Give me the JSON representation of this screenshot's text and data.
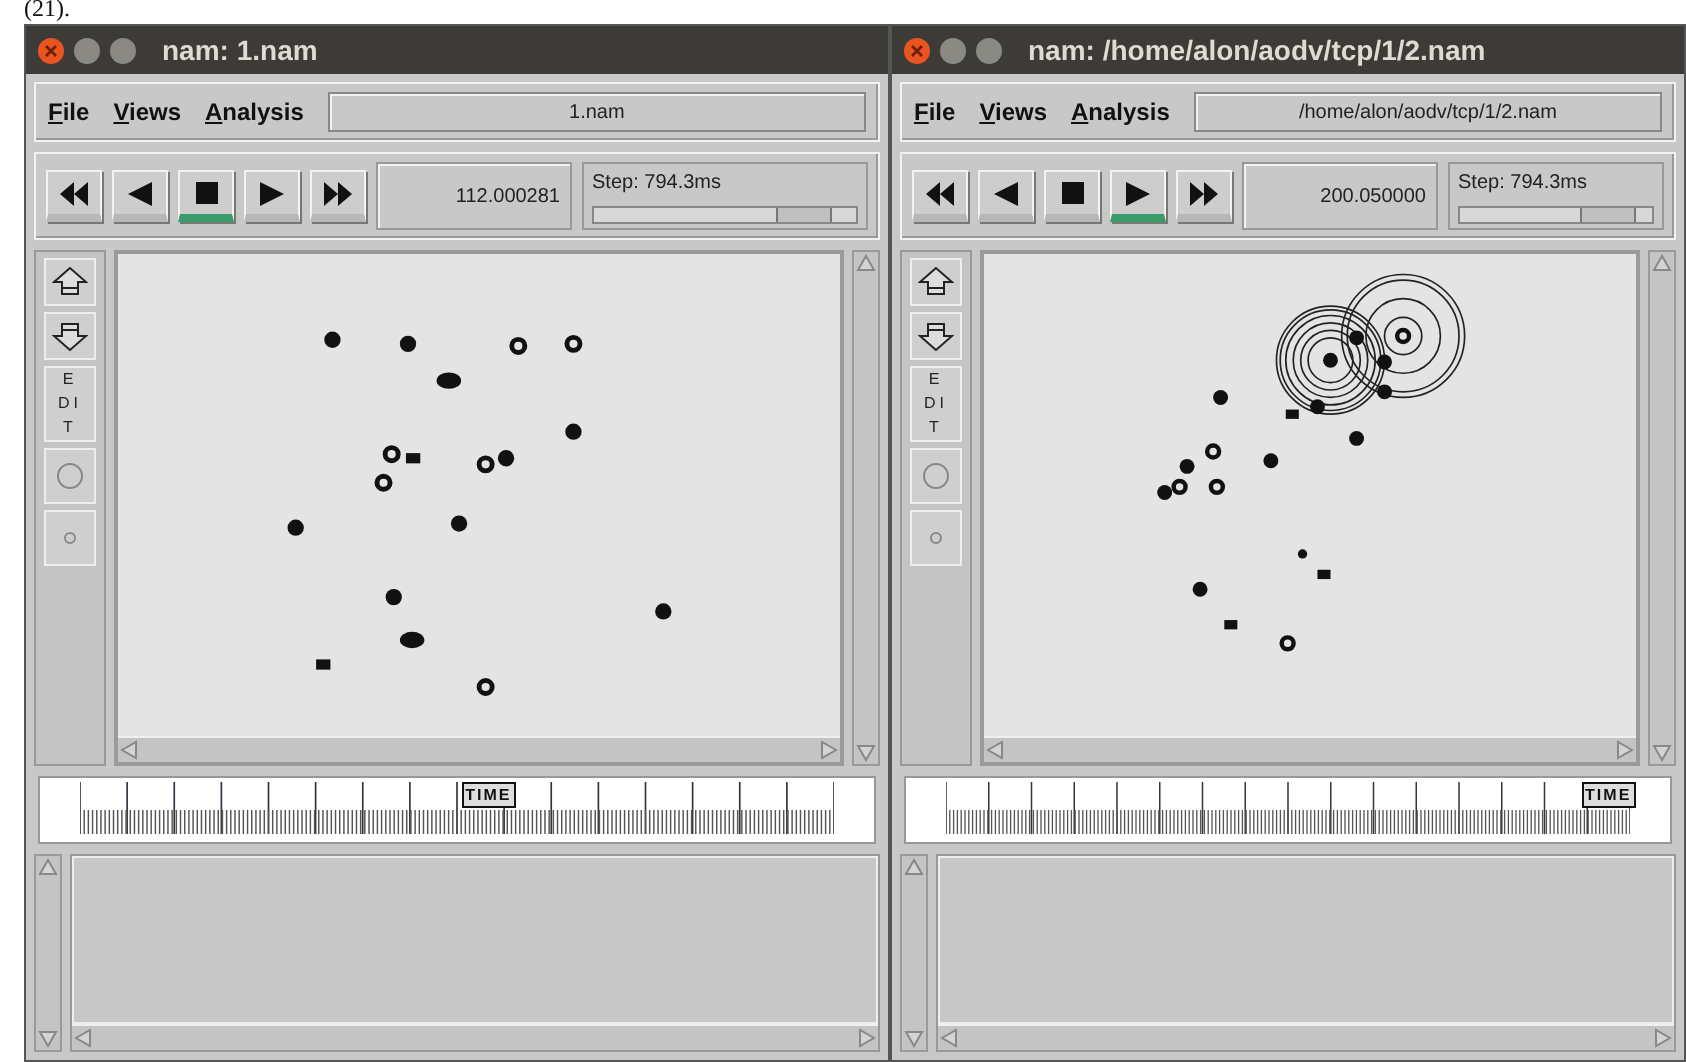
{
  "caption_fragment": "(21).",
  "windows": [
    {
      "title": "nam: 1.nam",
      "menus": [
        "File",
        "Views",
        "Analysis"
      ],
      "file_field": "1.nam",
      "transport": [
        {
          "kind": "rewind",
          "selected": false
        },
        {
          "kind": "back",
          "selected": false
        },
        {
          "kind": "stop",
          "selected": true
        },
        {
          "kind": "play",
          "selected": false
        },
        {
          "kind": "forward",
          "selected": false
        }
      ],
      "time": "112.000281",
      "step": {
        "label": "Step: 794.3ms",
        "level": 0.88
      },
      "edit_button": "EDIT",
      "timeline": {
        "label": "TIME",
        "level": 0.55
      }
    },
    {
      "title": "nam: /home/alon/aodv/tcp/1/2.nam",
      "menus": [
        "File",
        "Views",
        "Analysis"
      ],
      "file_field": "/home/alon/aodv/tcp/1/2.nam",
      "transport": [
        {
          "kind": "rewind",
          "selected": false
        },
        {
          "kind": "back",
          "selected": false
        },
        {
          "kind": "stop",
          "selected": false
        },
        {
          "kind": "play",
          "selected": true
        },
        {
          "kind": "forward",
          "selected": false
        }
      ],
      "time": "200.050000",
      "step": {
        "label": "Step: 794.3ms",
        "level": 0.88
      },
      "edit_button": "EDIT",
      "timeline": {
        "label": "TIME",
        "level": 0.97
      }
    }
  ]
}
